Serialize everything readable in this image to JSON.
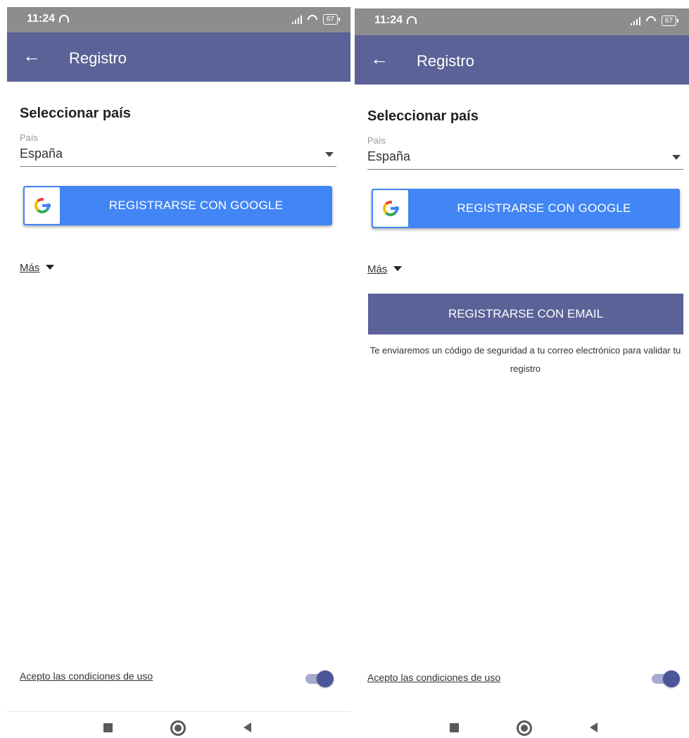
{
  "screens": {
    "left": {
      "status": {
        "time": "11:24",
        "battery": "67"
      },
      "app_bar": {
        "title": "Registro"
      },
      "section_title": "Seleccionar país",
      "country": {
        "label": "País",
        "value": "España"
      },
      "google_button": {
        "label": "REGISTRARSE CON GOOGLE"
      },
      "more_toggle": {
        "label": "Más"
      },
      "terms": {
        "label": "Acepto las condiciones de uso",
        "accepted": true
      }
    },
    "right": {
      "status": {
        "time": "11:24",
        "battery": "67"
      },
      "app_bar": {
        "title": "Registro"
      },
      "section_title": "Seleccionar país",
      "country": {
        "label": "País",
        "value": "España"
      },
      "google_button": {
        "label": "REGISTRARSE CON GOOGLE"
      },
      "more_toggle": {
        "label": "Más"
      },
      "email_button": {
        "label": "REGISTRARSE CON EMAIL"
      },
      "email_note": "Te enviaremos un código de seguridad a tu correo electrónico para validar tu registro",
      "terms": {
        "label": "Acepto las condiciones de uso",
        "accepted": true
      }
    }
  },
  "colors": {
    "app_bar": "#5a6297",
    "google_blue": "#4285f4",
    "status_bar": "#8d8d8d",
    "toggle_on": "#4c5699"
  }
}
